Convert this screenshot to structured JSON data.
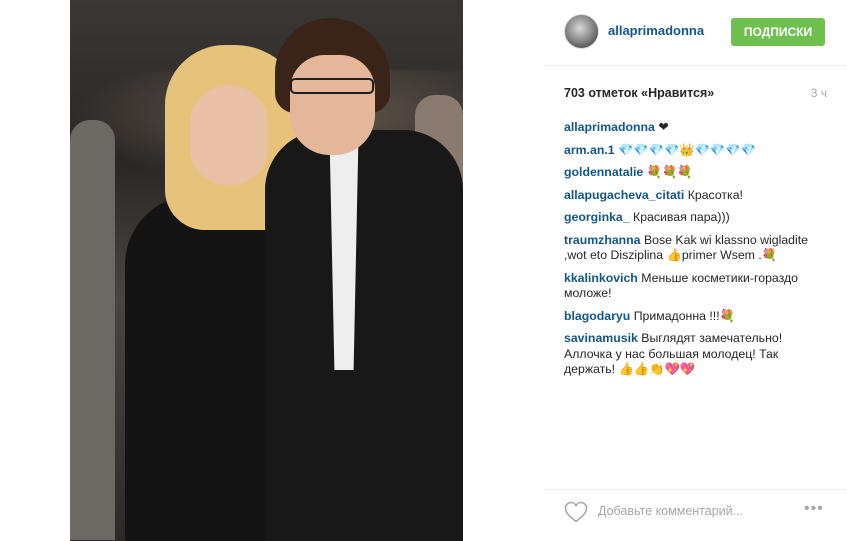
{
  "post": {
    "username": "allaprimadonna",
    "follow_label": "ПОДПИСКИ",
    "likes": "703 отметок «Нравится»",
    "time": "3 ч",
    "comments": [
      {
        "user": "allaprimadonna",
        "text": "❤"
      },
      {
        "user": "arm.an.1",
        "text": "💎💎💎💎👑💎💎💎💎"
      },
      {
        "user": "goldennatalie",
        "text": "💐💐💐"
      },
      {
        "user": "allapugacheva_citati",
        "text": "Красотка!"
      },
      {
        "user": "georginka_",
        "text": "Красивая пара)))"
      },
      {
        "user": "traumzhanna",
        "text": "Bose Kak wi klassno wigladite ,wot eto Disziplina 👍primer Wsem .💐"
      },
      {
        "user": "kkalinkovich",
        "text": "Меньше косметики-гораздо моложе!"
      },
      {
        "user": "blagodaryu",
        "text": "Примадонна !!!💐"
      },
      {
        "user": "savinamusik",
        "text": "Выглядят замечательно! Аллочка у нас большая молодец! Так держать! 👍👍👏💖💖"
      }
    ],
    "comment_placeholder": "Добавьте комментарий...",
    "more_label": "•••"
  },
  "icons": {
    "heart": "heart-icon",
    "more": "more-options-icon"
  },
  "colors": {
    "username": "#125688",
    "follow_button": "#70c050",
    "muted": "#a5a7aa"
  }
}
